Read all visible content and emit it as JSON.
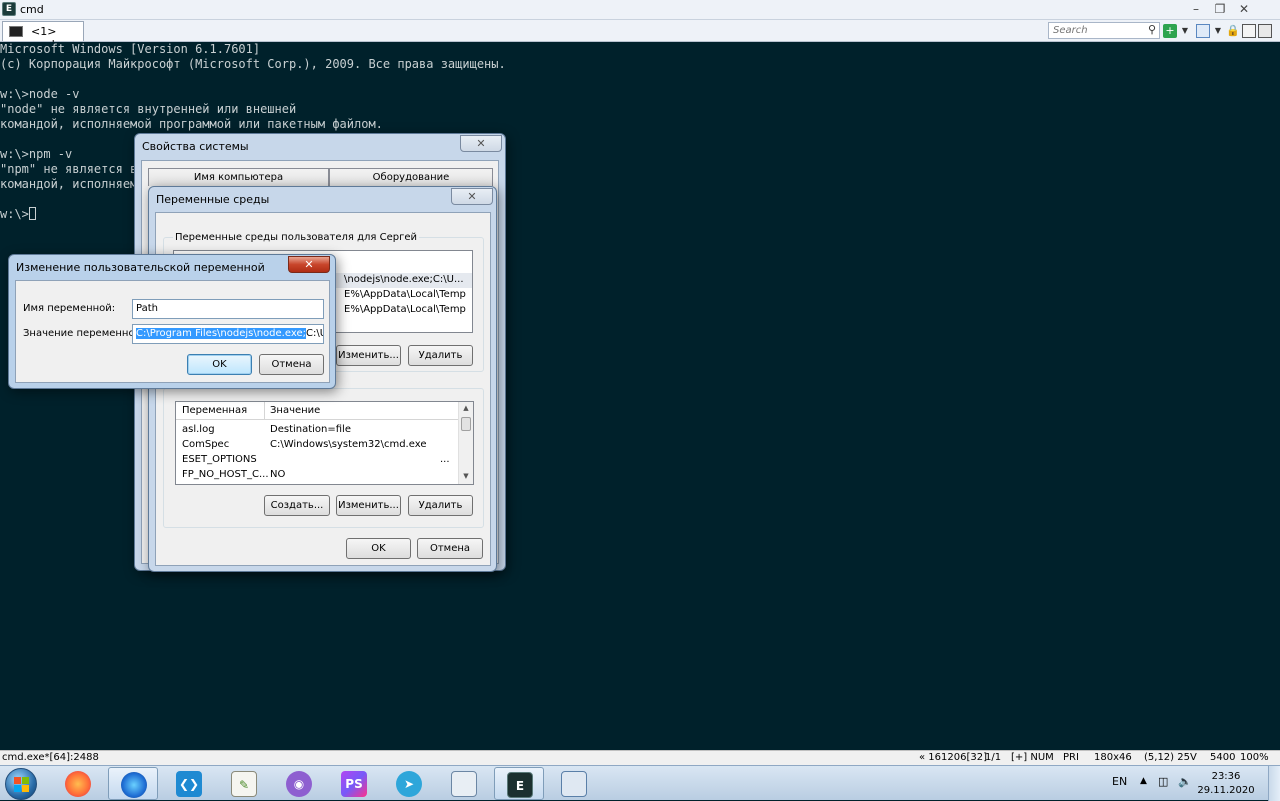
{
  "window": {
    "title": "cmd",
    "app_icon": "conemu-icon",
    "controls": {
      "minimize": "minimize-icon",
      "maximize": "restore-icon",
      "close": "close-icon"
    }
  },
  "tabs": [
    {
      "label": "<1> cmd",
      "icon": "console-icon"
    }
  ],
  "toolbar": {
    "search_placeholder": "Search"
  },
  "console": {
    "lines": [
      "Microsoft Windows [Version 6.1.7601]",
      "(c) Корпорация Майкрософт (Microsoft Corp.), 2009. Все права защищены.",
      "",
      "w:\\>node -v",
      "\"node\" не является внутренней или внешней",
      "командой, исполняемой программой или пакетным файлом.",
      "",
      "w:\\>npm -v",
      "\"npm\" не является в",
      "командой, исполняем",
      "",
      "w:\\>"
    ]
  },
  "system_properties": {
    "title": "Свойства системы",
    "tabs": [
      "Имя компьютера",
      "Оборудование"
    ]
  },
  "env_vars": {
    "title": "Переменные среды",
    "user_group_label": "Переменные среды пользователя для Сергей",
    "user_rows": [
      {
        "value": "\\nodejs\\node.exe;C:\\U..."
      },
      {
        "value": "E%\\AppData\\Local\\Temp"
      },
      {
        "value": "E%\\AppData\\Local\\Temp"
      }
    ],
    "user_edit_button": "Изменить...",
    "user_delete_button": "Удалить",
    "system_columns": [
      "Переменная",
      "Значение"
    ],
    "system_rows": [
      {
        "name": "asl.log",
        "value": "Destination=file"
      },
      {
        "name": "ComSpec",
        "value": "C:\\Windows\\system32\\cmd.exe"
      },
      {
        "name": "ESET_OPTIONS",
        "value": "..."
      },
      {
        "name": "FP_NO_HOST_C...",
        "value": "NO"
      }
    ],
    "create_button": "Создать...",
    "edit_button": "Изменить...",
    "delete_button": "Удалить",
    "ok_button": "OK",
    "cancel_button": "Отмена"
  },
  "edit_var": {
    "title": "Изменение пользовательской переменной",
    "name_label": "Имя переменной:",
    "name_value": "Path",
    "value_label": "Значение переменной:",
    "value_selected": "C:\\Program Files\\nodejs\\node.exe;",
    "value_rest": "C:\\Users",
    "ok_button": "OK",
    "cancel_button": "Отмена"
  },
  "statusbar": {
    "left": "cmd.exe*[64]:2488",
    "items": [
      "« 161206[32]",
      "1/1",
      "[+] NUM",
      "PRI",
      "180x46",
      "(5,12) 25V",
      "5400",
      "100%"
    ]
  },
  "taskbar": {
    "apps": [
      {
        "name": "firefox",
        "icon": "firefox-icon"
      },
      {
        "name": "firefox-developer",
        "icon": "firefox-dev-icon"
      },
      {
        "name": "vscode",
        "icon": "vscode-icon"
      },
      {
        "name": "notepad",
        "icon": "notepad-icon"
      },
      {
        "name": "github-desktop",
        "icon": "github-icon"
      },
      {
        "name": "phpstorm",
        "icon": "phpstorm-icon",
        "label": "PS"
      },
      {
        "name": "telegram",
        "icon": "telegram-icon"
      },
      {
        "name": "system-window",
        "icon": "system-window-icon"
      },
      {
        "name": "conemu",
        "icon": "conemu-icon"
      },
      {
        "name": "control-panel",
        "icon": "control-panel-icon"
      }
    ],
    "lang": "EN",
    "time": "23:36",
    "date": "29.11.2020"
  }
}
